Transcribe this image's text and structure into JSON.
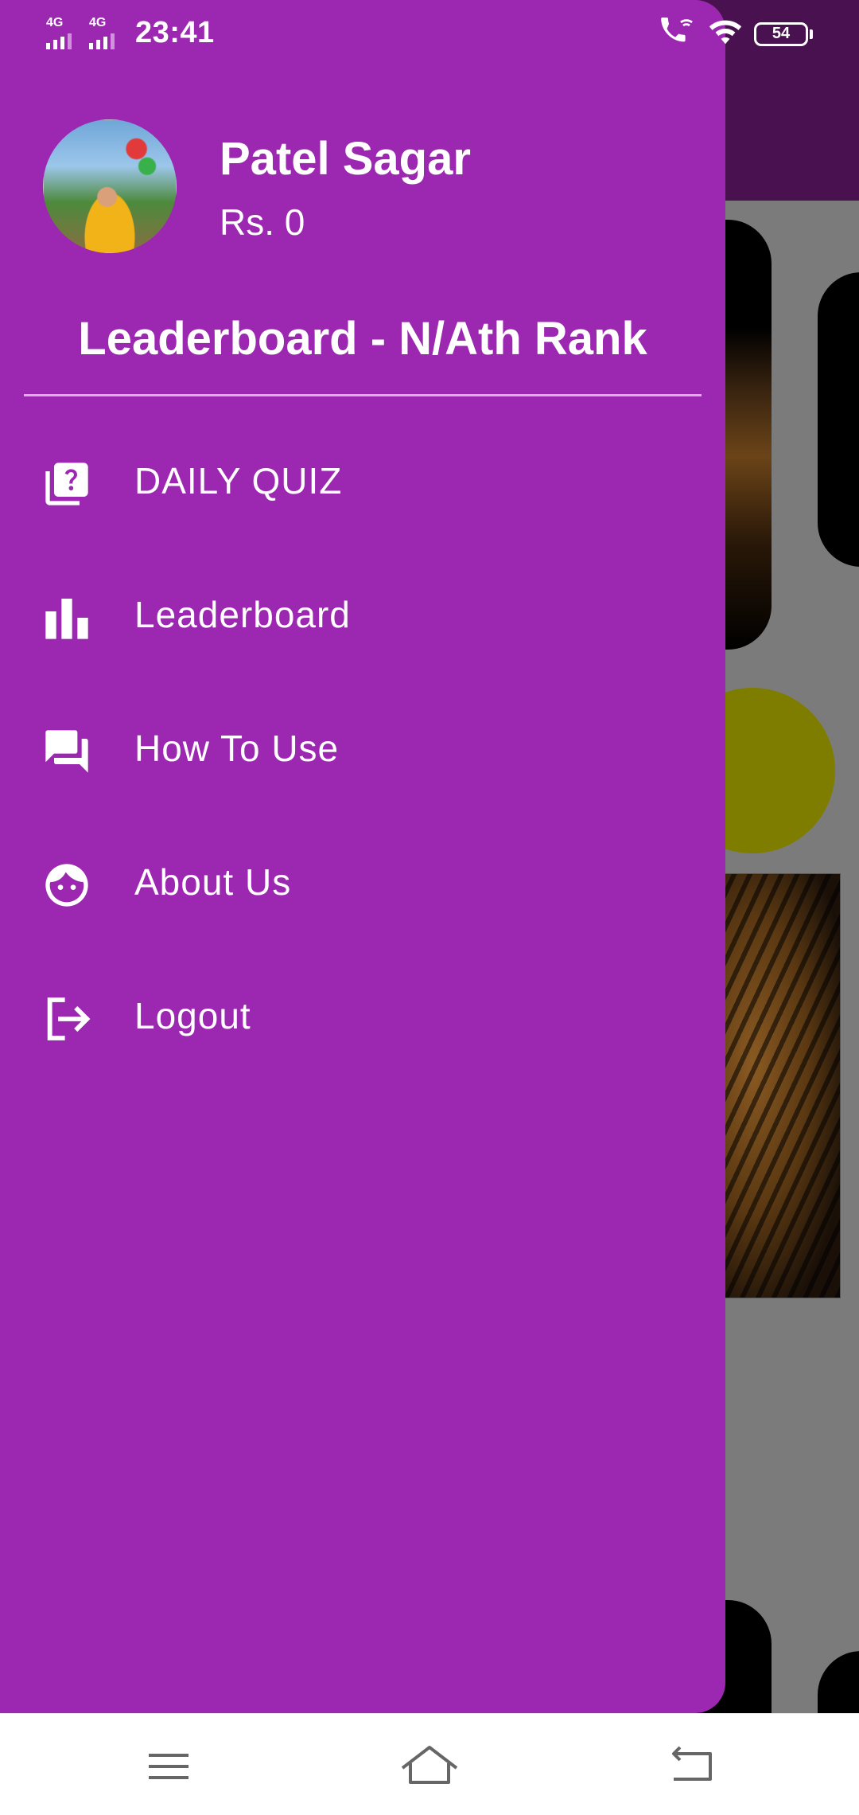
{
  "status_bar": {
    "signal_1": "4G",
    "signal_2": "4G",
    "time": "23:41",
    "battery": "54",
    "icons": [
      "wifi-call-icon",
      "wifi-icon",
      "battery-icon"
    ]
  },
  "profile": {
    "name": "Patel Sagar",
    "balance": "Rs. 0",
    "rank": "Leaderboard -  N/Ath Rank"
  },
  "menu": {
    "items": [
      {
        "label": "DAILY QUIZ",
        "icon": "quiz-icon"
      },
      {
        "label": "Leaderboard",
        "icon": "leaderboard-icon"
      },
      {
        "label": "How To Use",
        "icon": "forum-icon"
      },
      {
        "label": "About Us",
        "icon": "face-icon"
      },
      {
        "label": "Logout",
        "icon": "logout-icon"
      }
    ]
  },
  "colors": {
    "drawer": "#9c27b0",
    "app_bar_dimmed": "#4a1150",
    "scrim": "#7b7b7b",
    "nav_bar": "#ffffff"
  },
  "nav_bar": {
    "icons": [
      "menu-icon",
      "home-icon",
      "back-icon"
    ]
  }
}
